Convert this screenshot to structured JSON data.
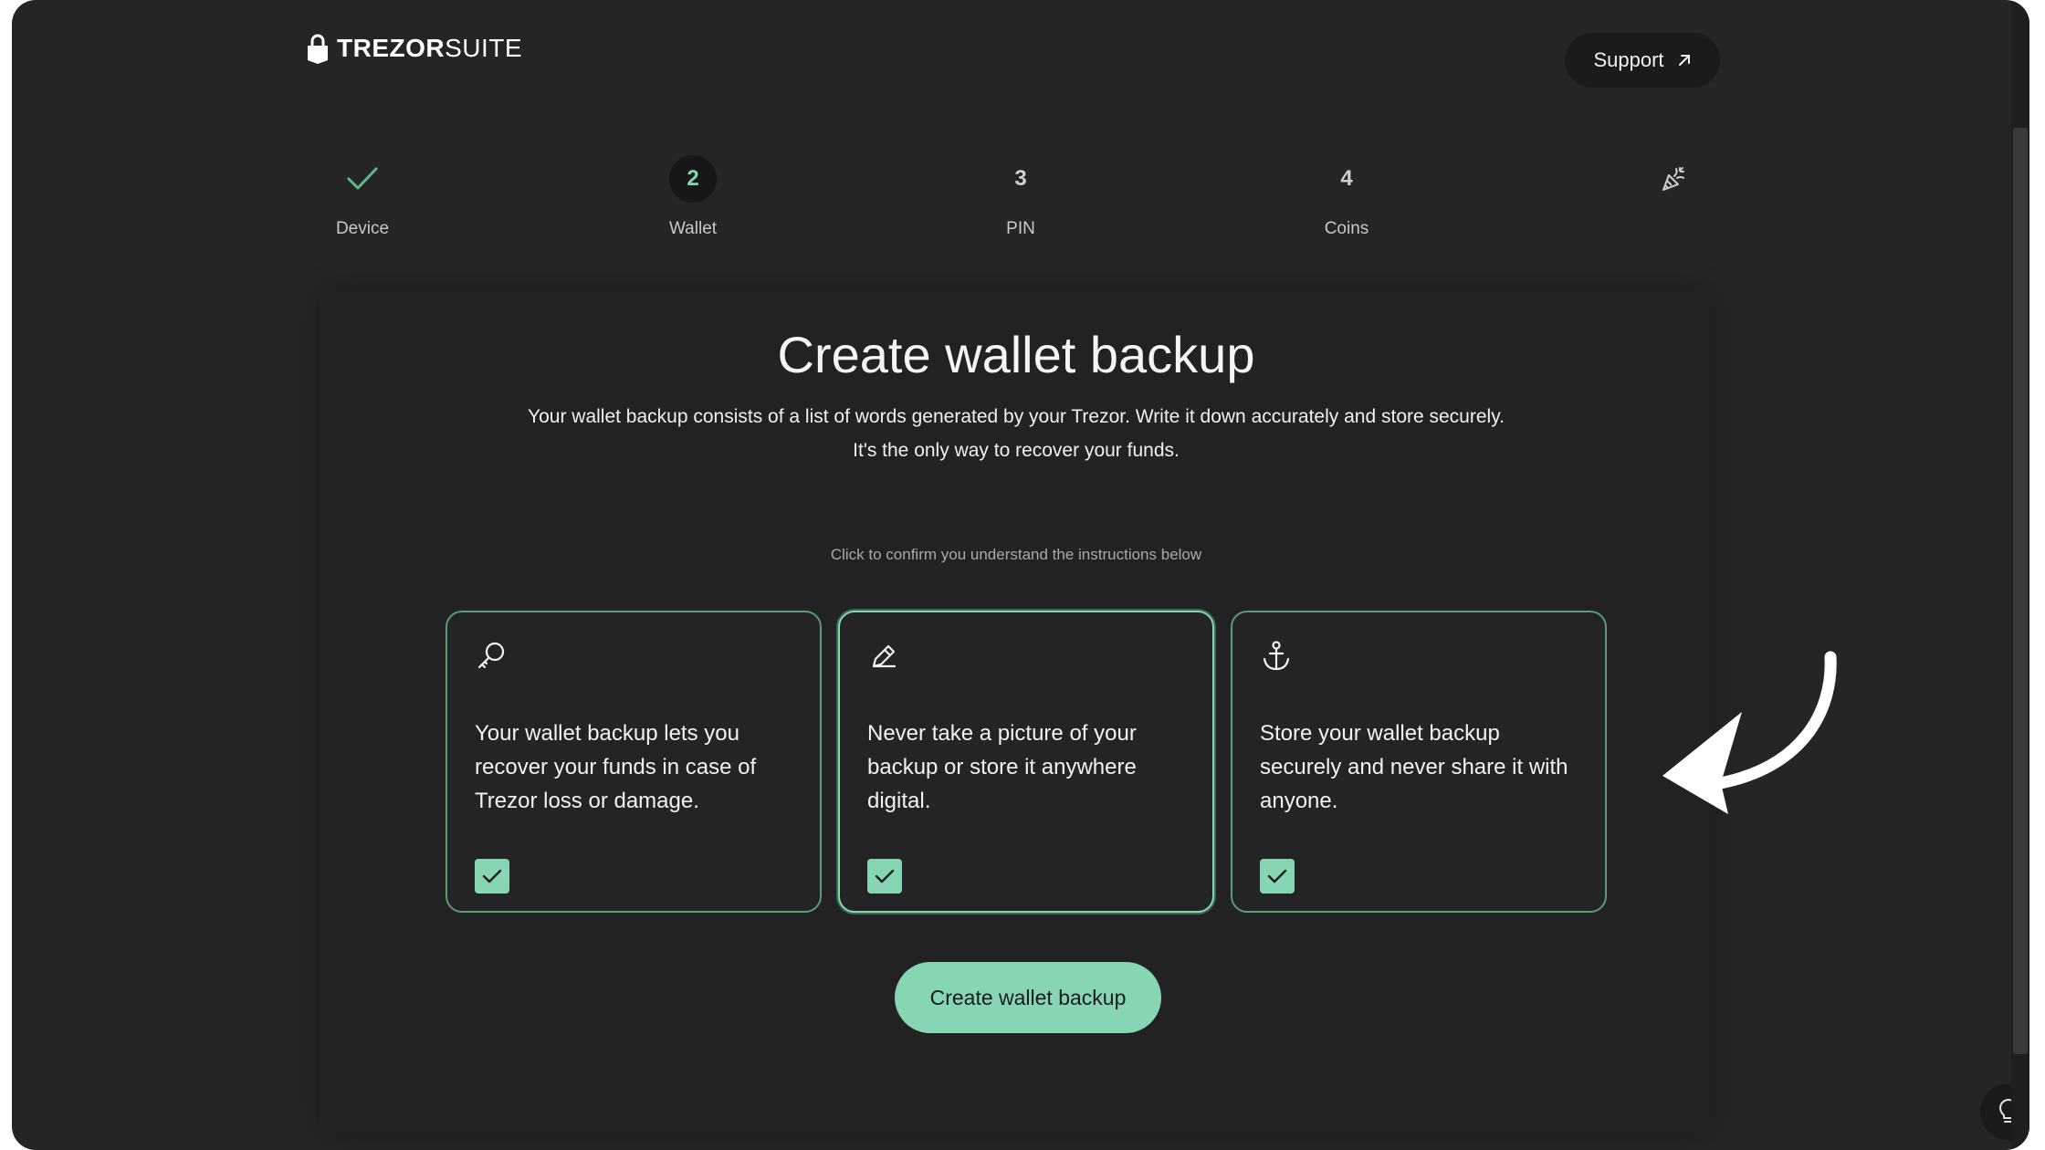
{
  "header": {
    "logo_bold": "TREZOR",
    "logo_light": "SUITE",
    "support_label": "Support"
  },
  "stepper": {
    "steps": [
      {
        "number": "",
        "label": "Device",
        "state": "done"
      },
      {
        "number": "2",
        "label": "Wallet",
        "state": "active"
      },
      {
        "number": "3",
        "label": "PIN",
        "state": "upcoming"
      },
      {
        "number": "4",
        "label": "Coins",
        "state": "upcoming"
      },
      {
        "number": "",
        "label": "",
        "state": "final"
      }
    ]
  },
  "main": {
    "title": "Create wallet backup",
    "subtitle_line1": "Your wallet backup consists of a list of words generated by your Trezor. Write it down accurately and store securely.",
    "subtitle_line2": "It's the only way to recover your funds.",
    "hint": "Click to confirm you understand the instructions below",
    "instructions": [
      {
        "icon": "key-icon",
        "text": "Your wallet backup lets you recover your funds in case of Trezor loss or damage.",
        "checked": true
      },
      {
        "icon": "pencil-icon",
        "text": "Never take a picture of your backup or store it anywhere digital.",
        "checked": true
      },
      {
        "icon": "anchor-icon",
        "text": "Store your wallet backup securely and never share it with anyone.",
        "checked": true
      }
    ],
    "create_button_label": "Create wallet backup"
  },
  "colors": {
    "background": "#252525",
    "accent": "#86d6b3",
    "border": "#5c9a78"
  }
}
